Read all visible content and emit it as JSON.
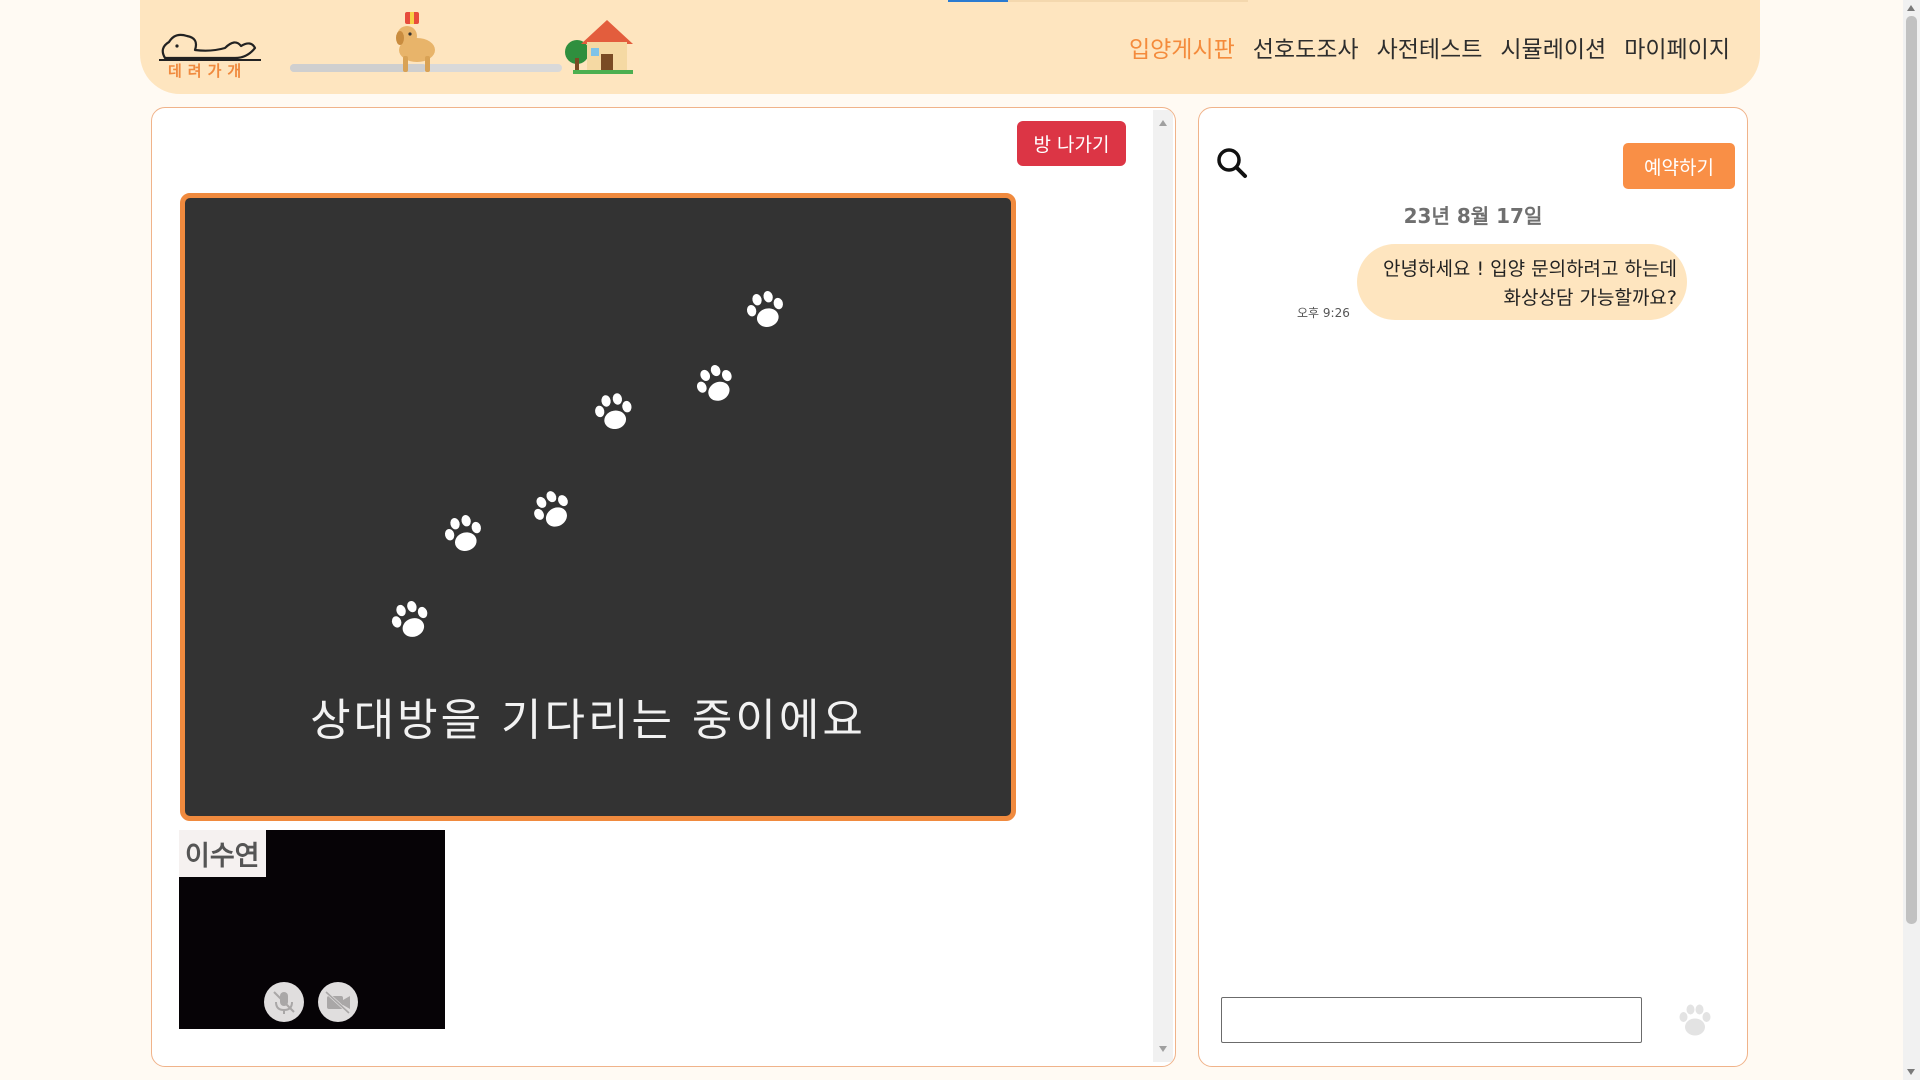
{
  "header": {
    "logo_text": "데려가개",
    "adoption_progress": 0.5,
    "nav": [
      {
        "label": "입양게시판",
        "active": true
      },
      {
        "label": "선호도조사",
        "active": false
      },
      {
        "label": "사전테스트",
        "active": false
      },
      {
        "label": "시뮬레이션",
        "active": false
      },
      {
        "label": "마이페이지",
        "active": false
      }
    ]
  },
  "video": {
    "leave_label": "방 나가기",
    "waiting_text": "상대방을 기다리는 중이에요",
    "participant_name": "이수연",
    "mic_icon": "mic-off-icon",
    "cam_icon": "camera-off-icon"
  },
  "chat": {
    "reserve_label": "예약하기",
    "date": "23년 8월 17일",
    "messages": [
      {
        "line1": "안녕하세요 ! 입양 문의하려고 하는데",
        "line2": "화상상담 가능할까요?",
        "time": "오후 9:26"
      }
    ],
    "input_value": ""
  },
  "colors": {
    "accent": "#f48b3c",
    "header_bg": "#fee5bf",
    "leave_button": "#dc3545",
    "reserve_button": "#f98f46"
  }
}
